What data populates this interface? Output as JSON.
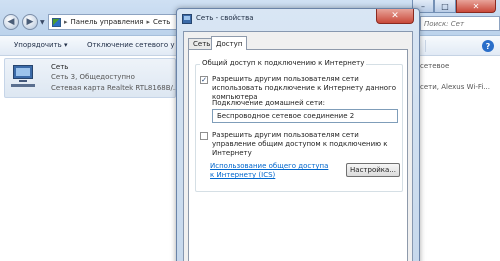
{
  "explorer": {
    "address": [
      "Панель управления",
      "Сеть"
    ],
    "search_placeholder": "Поиск: Сет",
    "toolbar": {
      "organize": "Упорядочить ▾",
      "disconnect": "Отключение сетевого у"
    },
    "item": {
      "name": "Сеть",
      "status": "Сеть 3, Общедоступно",
      "adapter": "Сетевая карта Realtek RTL8168B/..."
    },
    "right_peek": {
      "line1": "сетевое",
      "line2": "сети, Alexus Wi-Fi..."
    },
    "window_buttons": {
      "minimize": "–",
      "maximize": "□",
      "close": "✕"
    },
    "refresh_icon": "↻",
    "help_icon": "?"
  },
  "dialog": {
    "title": "Сеть - свойства",
    "close": "✕",
    "tabs": [
      "Сеть",
      "Доступ"
    ],
    "active_tab": "Доступ",
    "group_title": "Общий доступ к подключению к Интернету",
    "allow_sharing": {
      "checked": true,
      "mark": "✓",
      "label": "Разрешить другим пользователям сети использовать подключение к Интернету данного компьютера"
    },
    "home_connection_label": "Подключение домашней сети:",
    "home_connection_value": "Беспроводное сетевое соединение 2",
    "allow_control": {
      "checked": false,
      "mark": "",
      "label": "Разрешить другим пользователям сети управление общим доступом к подключению к Интернету"
    },
    "ics_link": "Использование общего доступа к Интернету (ICS)",
    "settings_button": "Настройка..."
  }
}
